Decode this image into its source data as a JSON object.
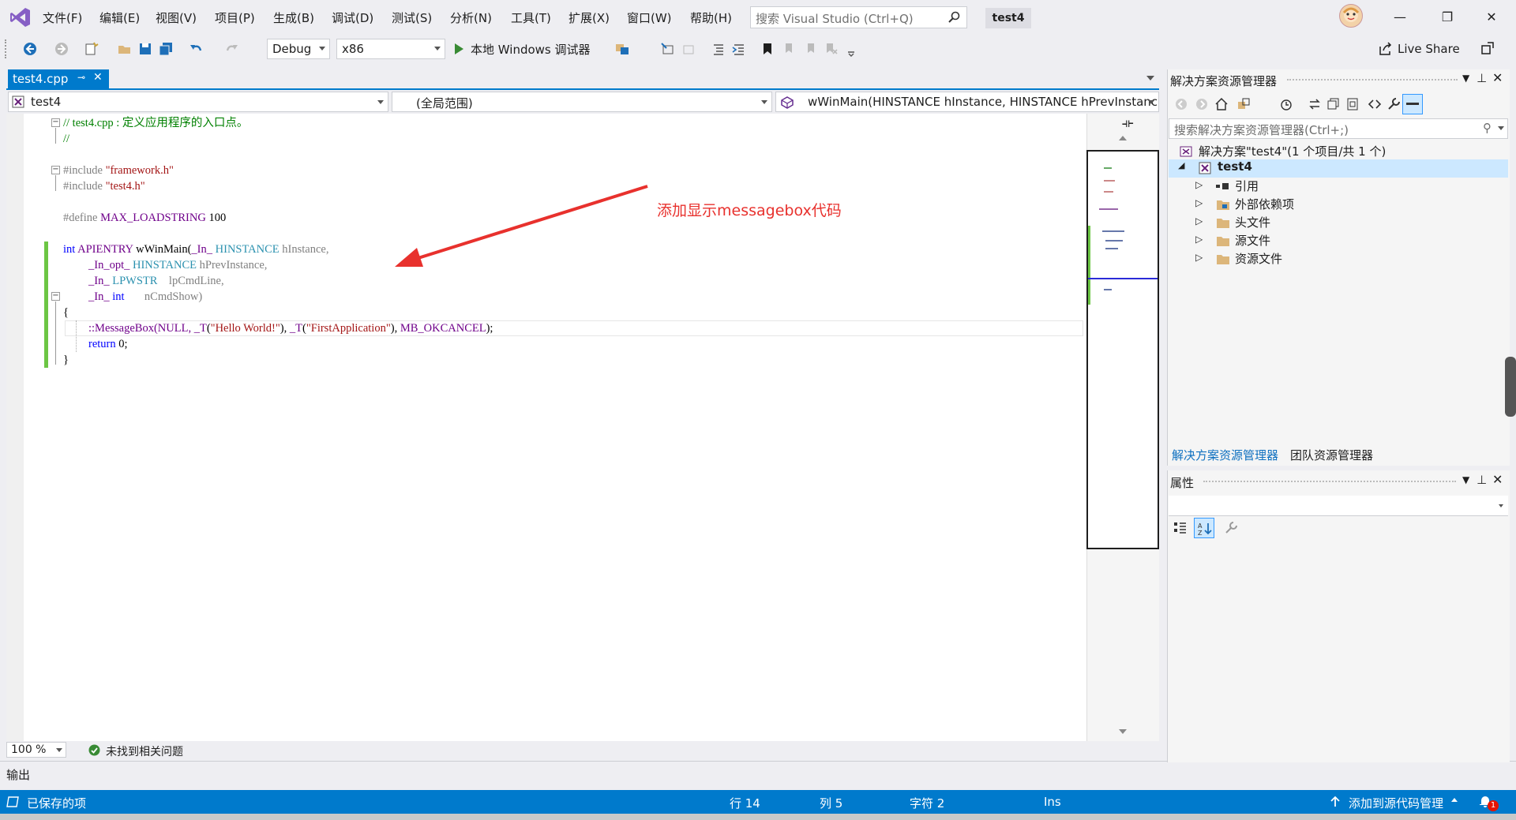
{
  "menu": {
    "items": [
      "文件(F)",
      "编辑(E)",
      "视图(V)",
      "项目(P)",
      "生成(B)",
      "调试(D)",
      "测试(S)",
      "分析(N)",
      "工具(T)",
      "扩展(X)",
      "窗口(W)",
      "帮助(H)"
    ],
    "search_placeholder": "搜索 Visual Studio (Ctrl+Q)",
    "solution_badge": "test4"
  },
  "window_controls": {
    "minimize": "—",
    "restore": "❐",
    "close": "✕"
  },
  "toolbar": {
    "config": "Debug",
    "platform": "x86",
    "run_label": "本地 Windows 调试器",
    "live_share": "Live Share"
  },
  "editor": {
    "tab_label": "test4.cpp",
    "nav_project": "test4",
    "nav_scope": "(全局范围)",
    "nav_member": "wWinMain(HINSTANCE hInstance, HINSTANCE hPrevInstanc",
    "zoom": "100 %",
    "issues": "未找到相关问题",
    "annotation": "添加显示messagebox代码",
    "code": {
      "l1": "// test4.cpp : 定义应用程序的入口点。",
      "l2": "//",
      "l4a": "#include ",
      "l4b": "\"framework.h\"",
      "l5a": "#include ",
      "l5b": "\"test4.h\"",
      "l7a": "#define ",
      "l7b": "MAX_LOADSTRING",
      "l7c": " 100",
      "l9a": "int",
      "l9b": " APIENTRY",
      "l9c": " wWinMain(",
      "l9d": "_In_",
      "l9e": " HINSTANCE",
      "l9f": " hInstance,",
      "l10a": "_In_opt_",
      "l10b": " HINSTANCE",
      "l10c": " hPrevInstance,",
      "l11a": "_In_",
      "l11b": " LPWSTR",
      "l11c": "    lpCmdLine,",
      "l12a": "_In_",
      "l12b": " int",
      "l12c": "       nCmdShow)",
      "l13": "{",
      "l14a": "::MessageBox(NULL, ",
      "l14b": "_T",
      "l14c": "(",
      "l14d": "\"Hello World!\"",
      "l14e": "), ",
      "l14f": "_T",
      "l14g": "(",
      "l14h": "\"FirstApplication\"",
      "l14i": "), ",
      "l14j": "MB_OKCANCEL",
      "l14k": ");",
      "l15a": "return",
      "l15b": " 0;",
      "l16": "}"
    }
  },
  "output": {
    "label": "输出"
  },
  "solution_explorer": {
    "title": "解决方案资源管理器",
    "search_placeholder": "搜索解决方案资源管理器(Ctrl+;)",
    "solution_node": "解决方案\"test4\"(1 个项目/共 1 个)",
    "project_node": "test4",
    "children": [
      "引用",
      "外部依赖项",
      "头文件",
      "源文件",
      "资源文件"
    ],
    "tab_active": "解决方案资源管理器",
    "tab_other": "团队资源管理器"
  },
  "properties": {
    "title": "属性"
  },
  "status": {
    "saved": "已保存的项",
    "line": "行 14",
    "col": "列 5",
    "char": "字符 2",
    "mode": "Ins",
    "source_control": "添加到源代码管理",
    "notifications": "1"
  },
  "colors": {
    "accent": "#007acc",
    "annotation": "#e8312d",
    "change_bar": "#6cc644"
  }
}
